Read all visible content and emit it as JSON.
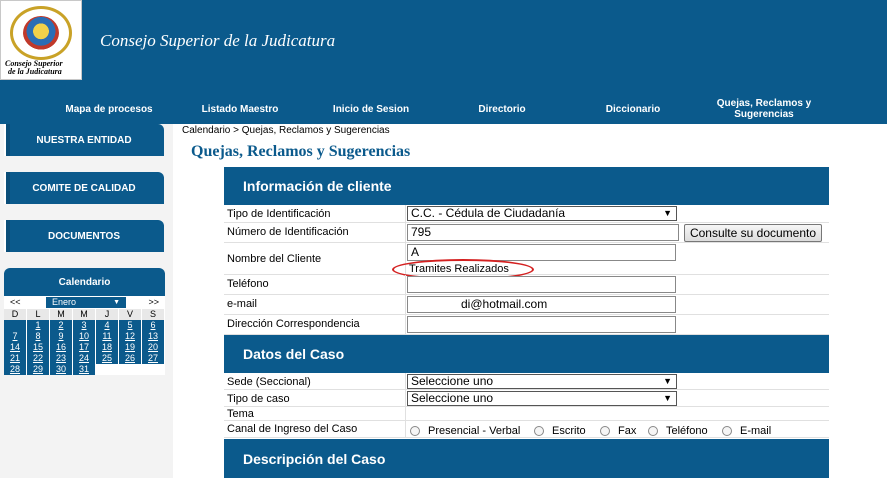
{
  "header": {
    "logo_text": [
      "Consejo Superior",
      "de la Judicatura"
    ],
    "logo_seal_text": "RAMA JUDICIAL REPÚBLICA DE COLOMBIA",
    "site_title": "Consejo Superior de la Judicatura"
  },
  "nav": {
    "items": [
      {
        "label": "Mapa de procesos"
      },
      {
        "label": "Listado Maestro"
      },
      {
        "label": "Inicio de Sesion"
      },
      {
        "label": "Directorio"
      },
      {
        "label": "Diccionario"
      },
      {
        "label": "Quejas, Reclamos y Sugerencias"
      }
    ]
  },
  "sidebar": {
    "items": [
      {
        "label": "NUESTRA ENTIDAD"
      },
      {
        "label": "COMITE DE CALIDAD"
      },
      {
        "label": "DOCUMENTOS"
      }
    ],
    "calendar": {
      "title": "Calendario",
      "prev": "<<",
      "next": ">>",
      "month": "Enero",
      "dow": [
        "D",
        "L",
        "M",
        "M",
        "J",
        "V",
        "S"
      ],
      "weeks": [
        [
          "",
          "1",
          "2",
          "3",
          "4",
          "5",
          "6"
        ],
        [
          "7",
          "8",
          "9",
          "10",
          "11",
          "12",
          "13"
        ],
        [
          "14",
          "15",
          "16",
          "17",
          "18",
          "19",
          "20"
        ],
        [
          "21",
          "22",
          "23",
          "24",
          "25",
          "26",
          "27"
        ],
        [
          "28",
          "29",
          "30",
          "31",
          null,
          null,
          null
        ]
      ]
    }
  },
  "breadcrumb": "Calendario >  Quejas, Reclamos y Sugerencias",
  "page_title": "Quejas, Reclamos y Sugerencias",
  "client_section": {
    "title": "Información de cliente",
    "id_type_label": "Tipo de Identificación",
    "id_type_value": "C.C. - Cédula de Ciudadanía",
    "id_number_label": "Número de Identificación",
    "id_number_value": "795",
    "consult_button": "Consulte su documento",
    "name_label": "Nombre del Cliente",
    "name_value": "A",
    "tramites_label": "Tramites Realizados",
    "phone_label": "Teléfono",
    "email_label": "e-mail",
    "email_value": "di@hotmail.com",
    "address_label": "Dirección Correspondencia"
  },
  "case_section": {
    "title": "Datos del Caso",
    "sede_label": "Sede (Seccional)",
    "sede_value": "Seleccione uno",
    "type_label": "Tipo de caso",
    "type_value": "Seleccione uno",
    "tema_label": "Tema",
    "canal_label": "Canal de Ingreso del Caso",
    "canal_options": [
      "Presencial - Verbal",
      "Escrito",
      "Fax",
      "Teléfono",
      "E-mail"
    ]
  },
  "description_section": {
    "title": "Descripción del Caso"
  },
  "colors": {
    "brand_blue": "#0b5a8c",
    "annotation_red": "#d42020"
  }
}
